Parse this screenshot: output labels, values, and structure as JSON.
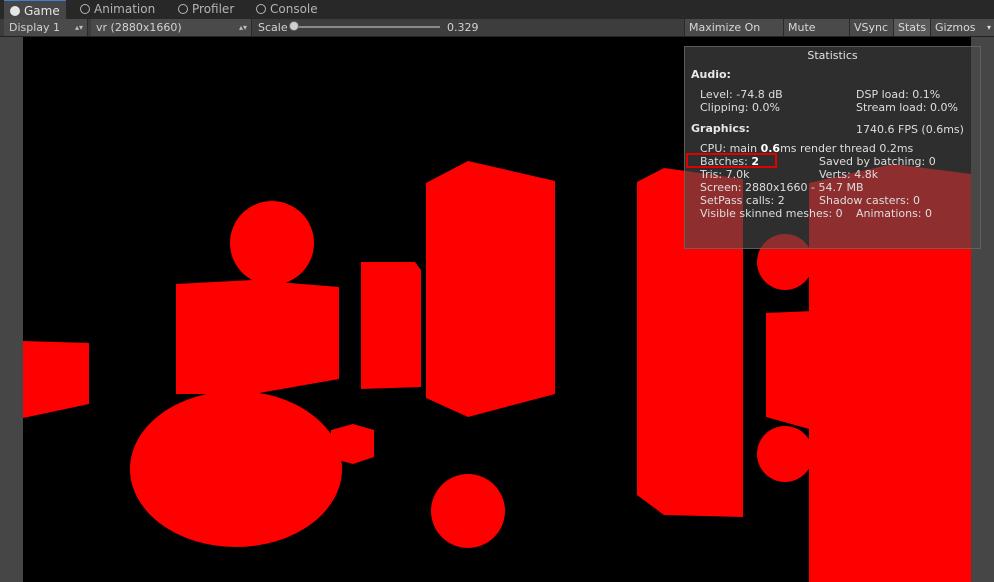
{
  "tabs": [
    {
      "label": "Game",
      "icon": "pacman-icon",
      "active": true
    },
    {
      "label": "Animation",
      "icon": "clock-icon",
      "active": false
    },
    {
      "label": "Profiler",
      "icon": "profiler-icon",
      "active": false
    },
    {
      "label": "Console",
      "icon": "console-icon",
      "active": false
    }
  ],
  "toolbar": {
    "display": "Display 1",
    "resolution": "vr (2880x1660)",
    "scale_label": "Scale",
    "scale_value": "0.329",
    "maximize": "Maximize On Play",
    "mute": "Mute Audio",
    "vsync": "VSync",
    "stats": "Stats",
    "gizmos": "Gizmos"
  },
  "stats": {
    "title": "Statistics",
    "audio_header": "Audio:",
    "level": "Level: -74.8 dB",
    "dsp": "DSP load: 0.1%",
    "clipping": "Clipping: 0.0%",
    "stream": "Stream load: 0.0%",
    "graphics_header": "Graphics:",
    "fps": "1740.6 FPS (0.6ms)",
    "cpu_prefix": "CPU: main ",
    "cpu_main": "0.6",
    "cpu_suffix": "ms  render thread 0.2ms",
    "batches_prefix": "Batches: ",
    "batches_value": "2",
    "saved_batching": "Saved by batching: 0",
    "tris": "Tris: 7.0k",
    "verts": "Verts: 4.8k",
    "screen": "Screen: 2880x1660 - 54.7 MB",
    "setpass": "SetPass calls: 2",
    "shadow": "Shadow casters: 0",
    "skinned": "Visible skinned meshes: 0",
    "animations": "Animations: 0"
  },
  "colors": {
    "scene_object": "#ff0000",
    "viewport_bg": "#000000",
    "highlight": "#e00000",
    "tab_active_accent": "#3c7fd6"
  }
}
